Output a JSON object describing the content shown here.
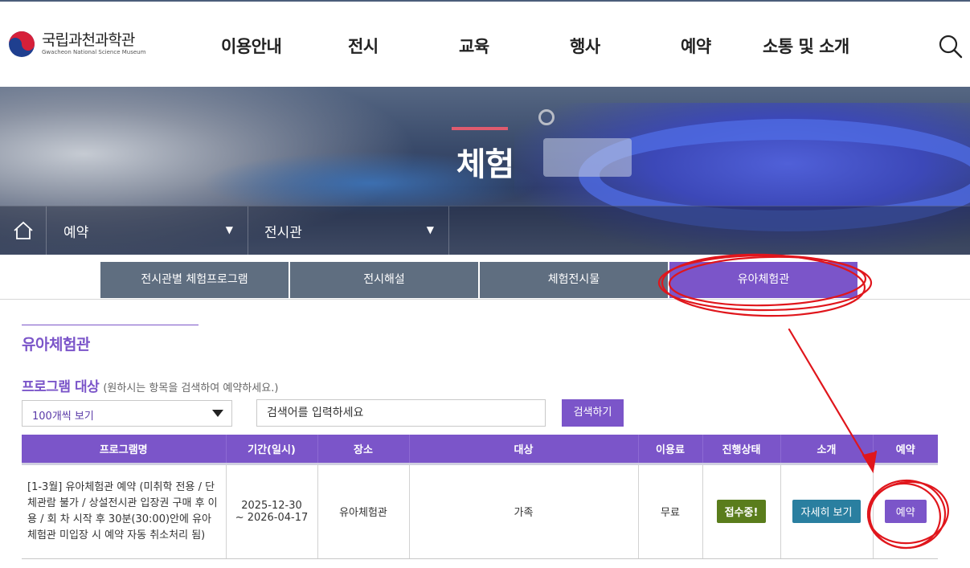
{
  "header": {
    "logo_ko": "국립과천과학관",
    "logo_en": "Gwacheon National Science Museum",
    "nav": [
      "이용안내",
      "전시",
      "교육",
      "행사",
      "예약",
      "소통 및 소개"
    ]
  },
  "banner": {
    "title": "체험"
  },
  "location": {
    "depth1": "예약",
    "depth2": "전시관"
  },
  "tabs": [
    "전시관별 체험프로그램",
    "전시해설",
    "체험전시물",
    "유아체험관"
  ],
  "active_tab_index": 3,
  "section": {
    "title": "유아체험관",
    "program_target_label": "프로그램 대상",
    "program_target_hint": "(원하시는 항목을 검색하여 예약하세요.)"
  },
  "search": {
    "page_size_selected": "100개씩 보기",
    "placeholder": "검색어를 입력하세요",
    "button": "검색하기"
  },
  "table": {
    "headers": [
      "프로그램명",
      "기간(일시)",
      "장소",
      "대상",
      "이용료",
      "진행상태",
      "소개",
      "예약"
    ],
    "rows": [
      {
        "program": "[1-3월] 유아체험관 예약 (미취학 전용 / 단체관람 불가 / 상설전시관 입장권 구매 후 이용 / 회 차 시작 후 30분(30:00)안에 유아체험관 미입장 시 예약 자동 취소처리 됨)",
        "period_start": "2025-12-30",
        "period_end": "~ 2026-04-17",
        "place": "유아체험관",
        "target": "가족",
        "fee": "무료",
        "status": "접수중!",
        "detail_button": "자세히 보기",
        "reserve_button": "예약"
      }
    ]
  },
  "colors": {
    "accent_purple": "#7b55c9",
    "tab_gray": "#5f6e80",
    "status_green": "#5a7d1c",
    "detail_blue": "#2a7fa0",
    "annotation_red": "#e0161c"
  }
}
